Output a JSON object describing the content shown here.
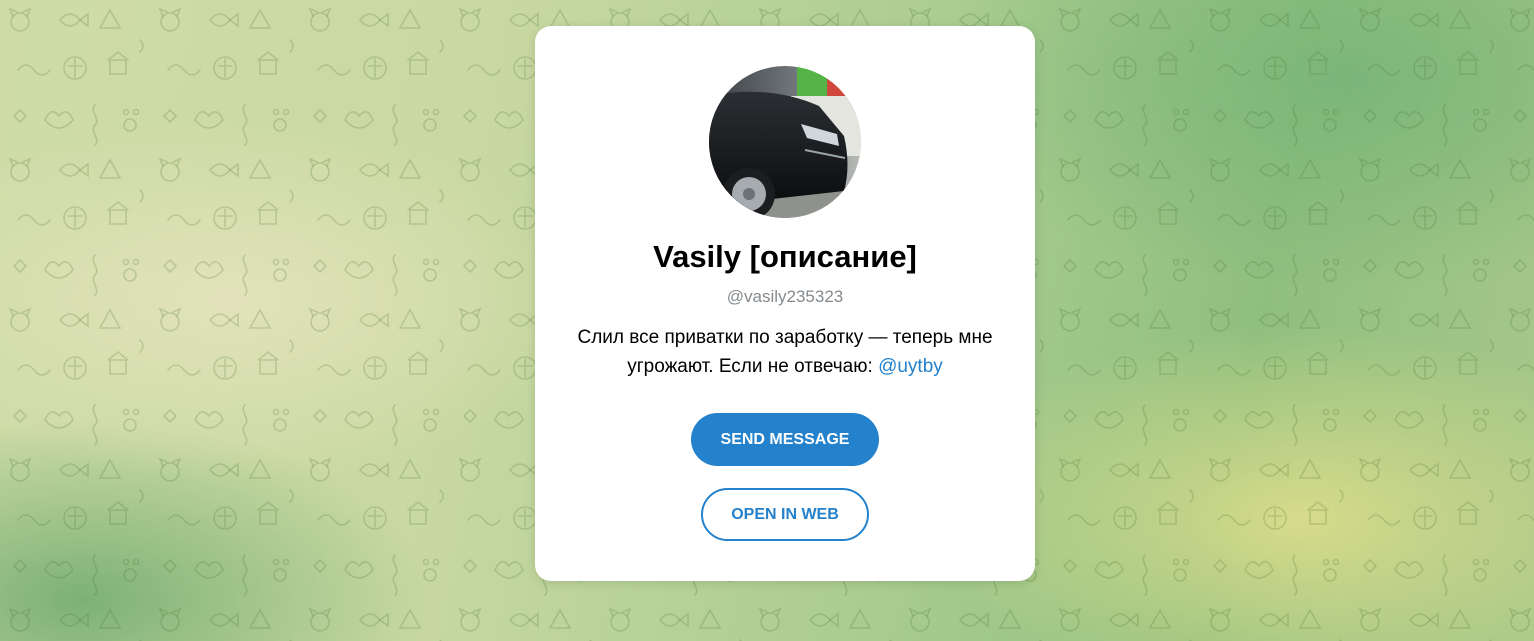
{
  "profile": {
    "name": "Vasily [описание]",
    "username": "@vasily235323",
    "bio_text": "Слил все приватки по заработку — теперь мне угрожают. Если не отвечаю: ",
    "bio_mention": "@uytby",
    "avatar": "profile-photo"
  },
  "actions": {
    "send_message": "SEND MESSAGE",
    "open_in_web": "OPEN IN WEB"
  },
  "colors": {
    "accent": "#2481cc",
    "muted_text": "#858a8e",
    "card": "#ffffff"
  },
  "background": {
    "pattern": "telegram-doodle-pattern"
  }
}
